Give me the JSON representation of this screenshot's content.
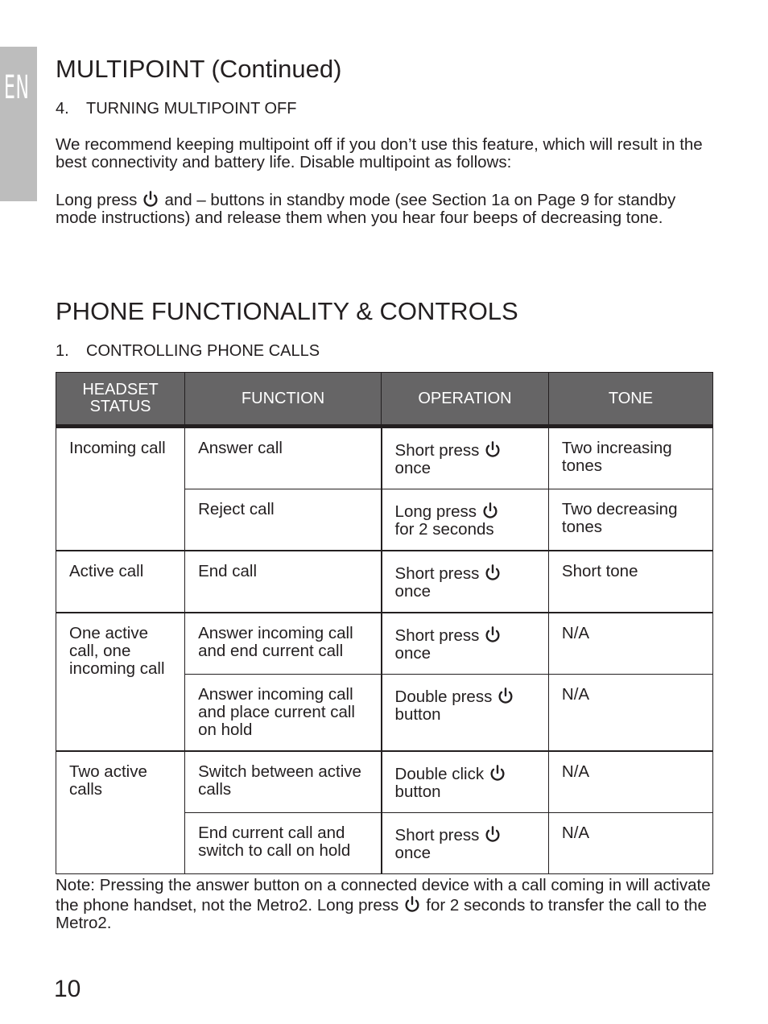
{
  "lang_tab": "EN",
  "multipoint": {
    "title": "MULTIPOINT (Continued)",
    "section_num": "4.",
    "section_title": "TURNING MULTIPOINT OFF",
    "para1": "We recommend keeping multipoint off if you don’t use this feature, which will result in the best connectivity and battery life.  Disable multipoint as follows:",
    "para2_before_icon": "Long press",
    "para2_after_icon": "and – buttons in standby mode (see Section 1a on Page 9 for standby mode instructions) and release them when you hear four beeps of decreasing tone.",
    "icon": "power-icon"
  },
  "phone": {
    "title": "PHONE FUNCTIONALITY & CONTROLS",
    "section_num": "1.",
    "section_title": "CONTROLLING PHONE CALLS",
    "table": {
      "headers": [
        "HEADSET STATUS",
        "FUNCTION",
        "OPERATION",
        "TONE"
      ],
      "rows": [
        {
          "status": "Incoming call",
          "function": "Answer call",
          "operation_before": "Short press",
          "operation_after": "once",
          "icon": "power-icon",
          "tone": "Two increasing tones"
        },
        {
          "status": "",
          "function": "Reject call",
          "operation_before": "Long press",
          "operation_after": "for 2 seconds",
          "icon": "power-icon",
          "tone": "Two decreasing tones"
        },
        {
          "status": "Active call",
          "function": "End call",
          "operation_before": "Short press",
          "operation_after": "once",
          "icon": "power-icon",
          "tone": "Short tone"
        },
        {
          "status": "One active call, one incoming call",
          "function": "Answer incoming call and end current call",
          "operation_before": "Short press",
          "operation_after": "once",
          "icon": "power-icon",
          "tone": "N/A"
        },
        {
          "status": "",
          "function": "Answer incoming call and place current call on hold",
          "operation_before": "Double press",
          "operation_after": "button",
          "icon": "power-icon",
          "tone": "N/A"
        },
        {
          "status": "Two active calls",
          "function": "Switch between active calls",
          "operation_before": "Double click",
          "operation_after": "button",
          "icon": "power-icon",
          "tone": "N/A"
        },
        {
          "status": "",
          "function": "End current call and switch to call on hold",
          "operation_before": "Short press",
          "operation_after": "once",
          "icon": "power-icon",
          "tone": "N/A"
        }
      ]
    },
    "note_before_icon": "Note: Pressing the answer button on a connected device with a call coming in will activate the phone handset, not the Metro2. Long press",
    "note_after_icon": "for 2 seconds to transfer the call to the Metro2."
  },
  "page_number": "10"
}
